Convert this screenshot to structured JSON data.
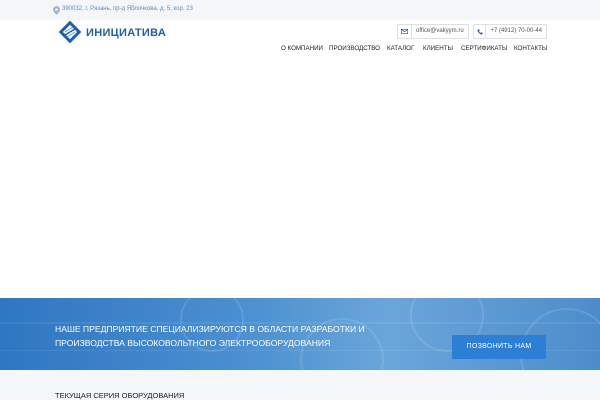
{
  "topbar": {
    "address": "390032, г. Рязань, пр-д Яблочкова, д. 5, кор. 23"
  },
  "header": {
    "logo_text": "ИНИЦИАТИВА",
    "email": "office@vakyym.ru",
    "phone": "+7 (4912) 70-00-44"
  },
  "nav": {
    "items": [
      "О КОМПАНИИ",
      "ПРОИЗВОДСТВО",
      "КАТАЛОГ",
      "КЛИЕНТЫ",
      "СЕРТИФИКАТЫ",
      "КОНТАКТЫ"
    ]
  },
  "banner": {
    "text": "НАШЕ ПРЕДПРИЯТИЕ СПЕЦИАЛИЗИРУЮТСЯ В ОБЛАСТИ РАЗРАБОТКИ И ПРОИЗВОДСТВА ВЫСОКОВОЛЬТНОГО ЭЛЕКТРООБОРУДОВАНИЯ",
    "button_label": "ПОЗВОНИТЬ НАМ"
  },
  "series": {
    "title": "ТЕКУЩАЯ СЕРИЯ ОБОРУДОВАНИЯ"
  },
  "colors": {
    "brand": "#1f5fa8",
    "accent": "#2d7fd6",
    "banner": "#4a8fd0"
  }
}
